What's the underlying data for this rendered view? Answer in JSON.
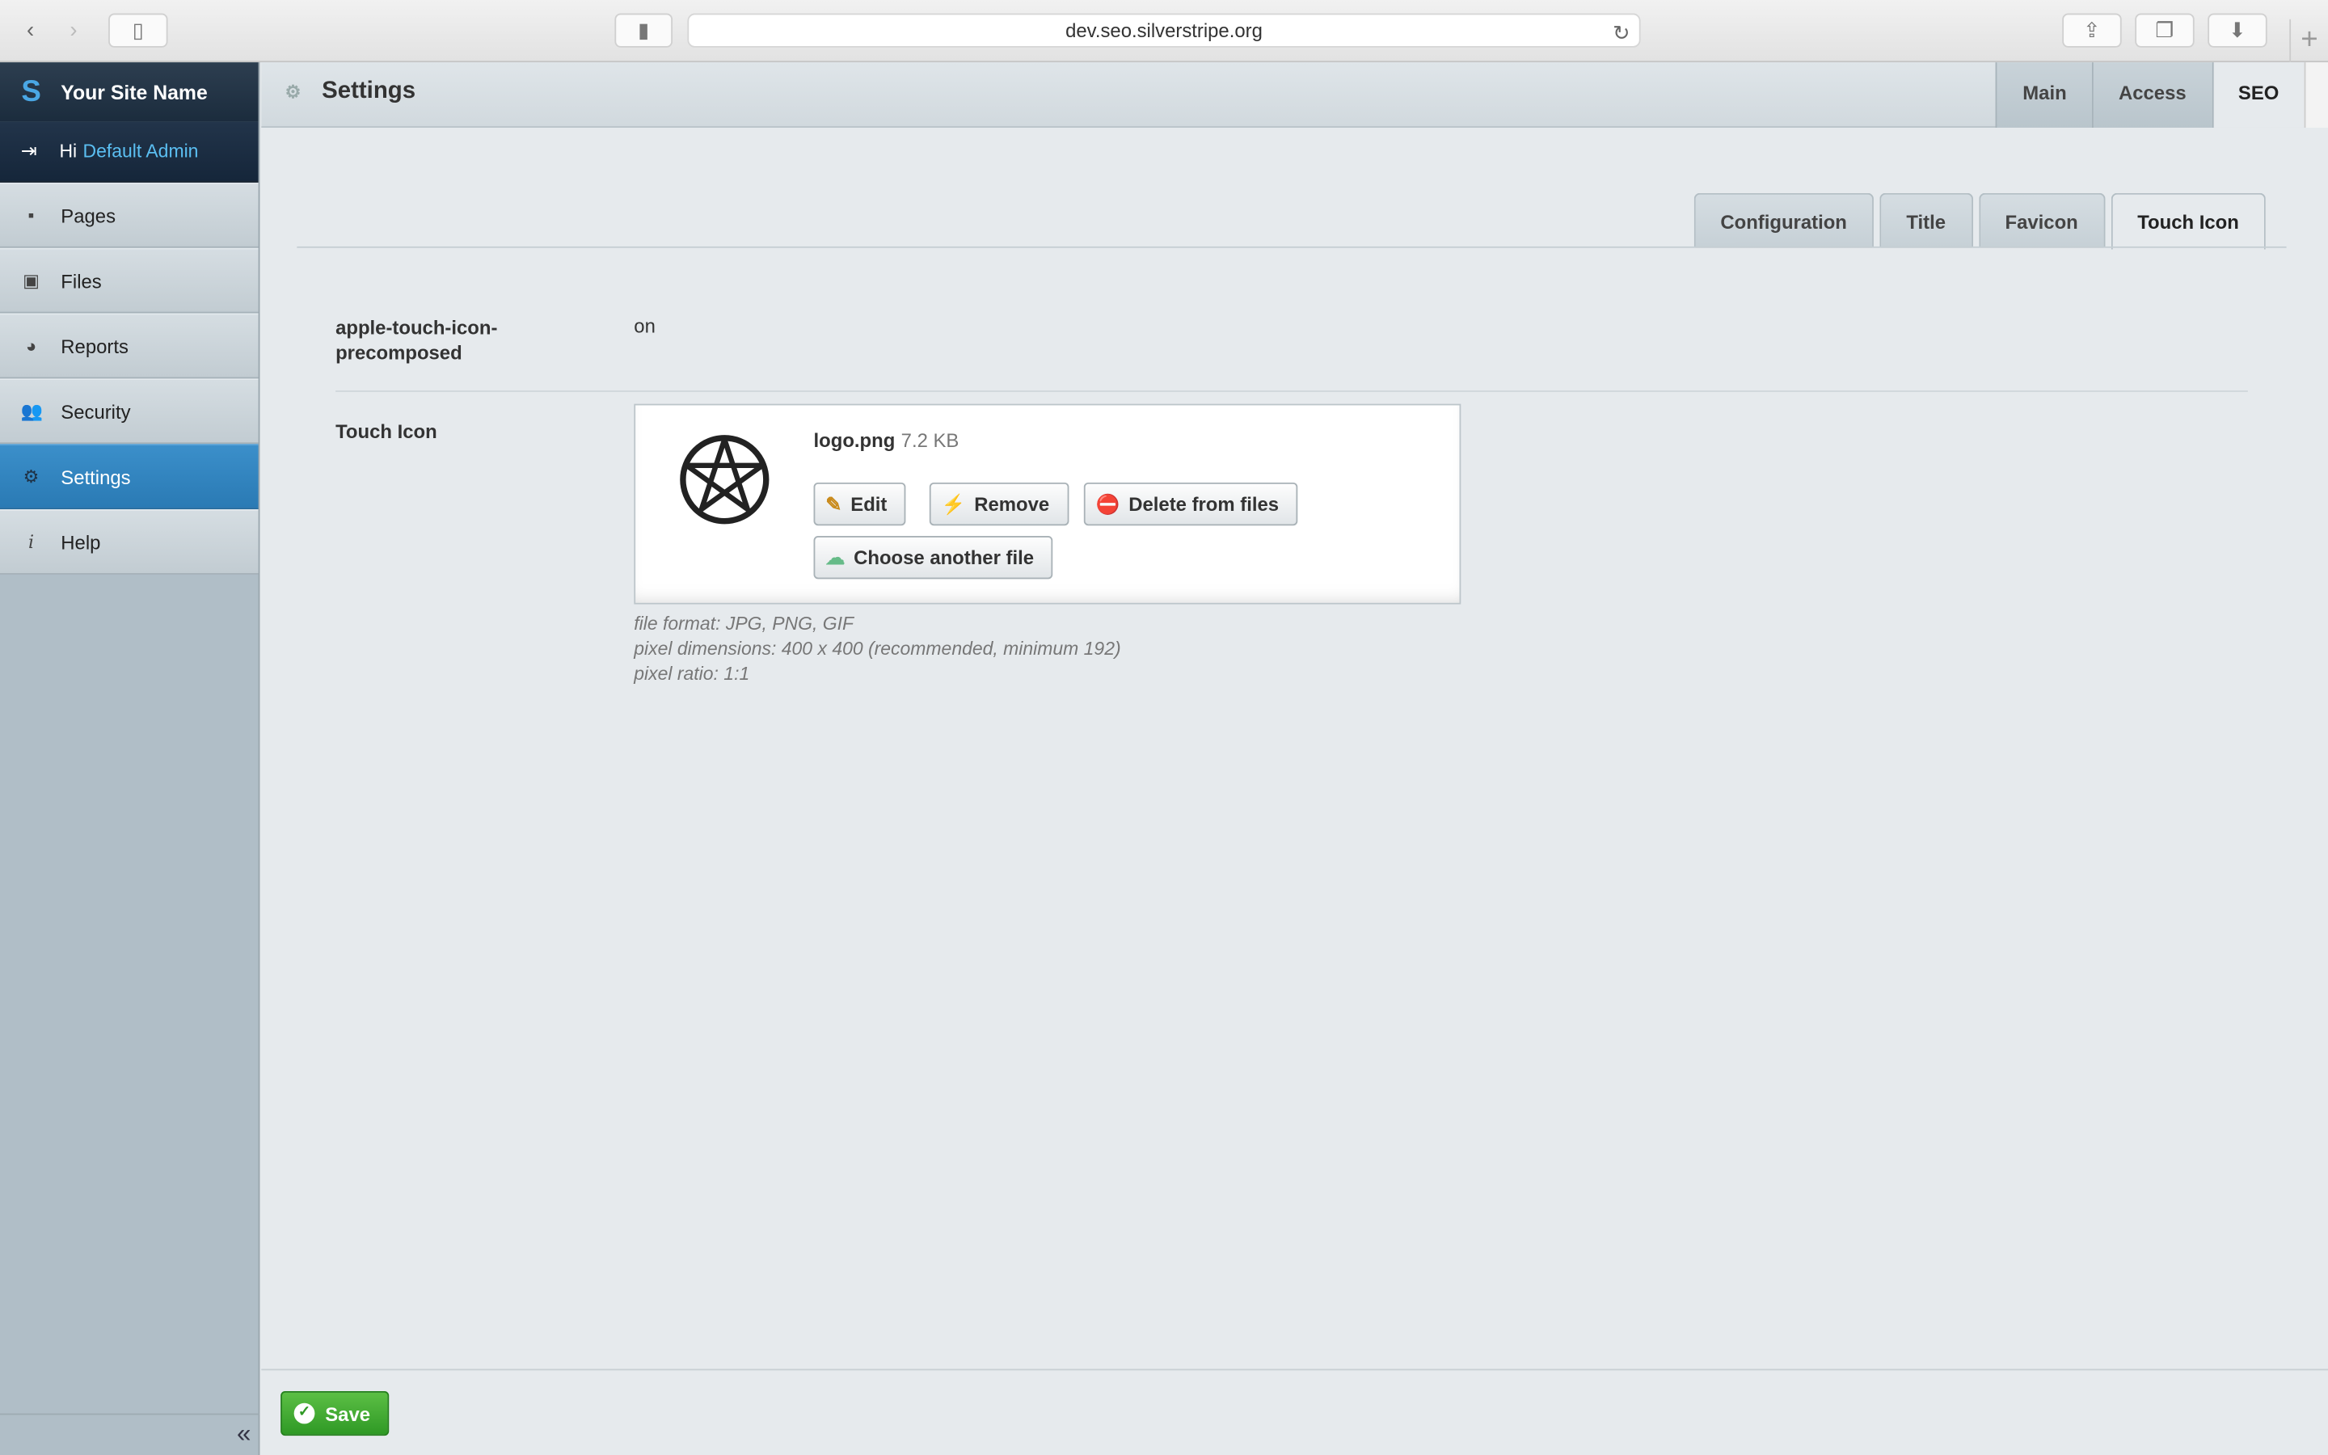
{
  "browser": {
    "url": "dev.seo.silverstripe.org",
    "back_icon": "chevron-left-icon",
    "forward_icon": "chevron-right-icon"
  },
  "sidebar": {
    "site_name": "Your Site Name",
    "greeting_prefix": "Hi",
    "user_name": "Default Admin",
    "items": [
      {
        "label": "Pages",
        "icon": "sitemap-icon"
      },
      {
        "label": "Files",
        "icon": "image-icon"
      },
      {
        "label": "Reports",
        "icon": "pie-chart-icon"
      },
      {
        "label": "Security",
        "icon": "users-icon"
      },
      {
        "label": "Settings",
        "icon": "gears-icon",
        "active": true
      },
      {
        "label": "Help",
        "icon": "info-icon"
      }
    ],
    "collapse_label": "«"
  },
  "header": {
    "title": "Settings",
    "tabs": [
      {
        "label": "Main"
      },
      {
        "label": "Access"
      },
      {
        "label": "SEO",
        "active": true
      }
    ]
  },
  "sub_tabs": [
    {
      "label": "Configuration"
    },
    {
      "label": "Title"
    },
    {
      "label": "Favicon"
    },
    {
      "label": "Touch Icon",
      "active": true
    }
  ],
  "fields": {
    "precomposed_label": "apple-touch-icon-precomposed",
    "precomposed_value": "on",
    "touch_icon_label": "Touch Icon"
  },
  "upload": {
    "file_name": "logo.png",
    "file_size": "7.2 KB",
    "edit_label": "Edit",
    "remove_label": "Remove",
    "delete_label": "Delete from files",
    "choose_label": "Choose another file",
    "hints": [
      "file format: JPG, PNG, GIF",
      "pixel dimensions: 400 x 400 (recommended, minimum 192)",
      "pixel ratio: 1:1"
    ]
  },
  "footer": {
    "save_label": "Save"
  },
  "colors": {
    "accent": "#2a7ab4",
    "save_green": "#3aa52e",
    "brand_dark": "#1b2c3d"
  }
}
